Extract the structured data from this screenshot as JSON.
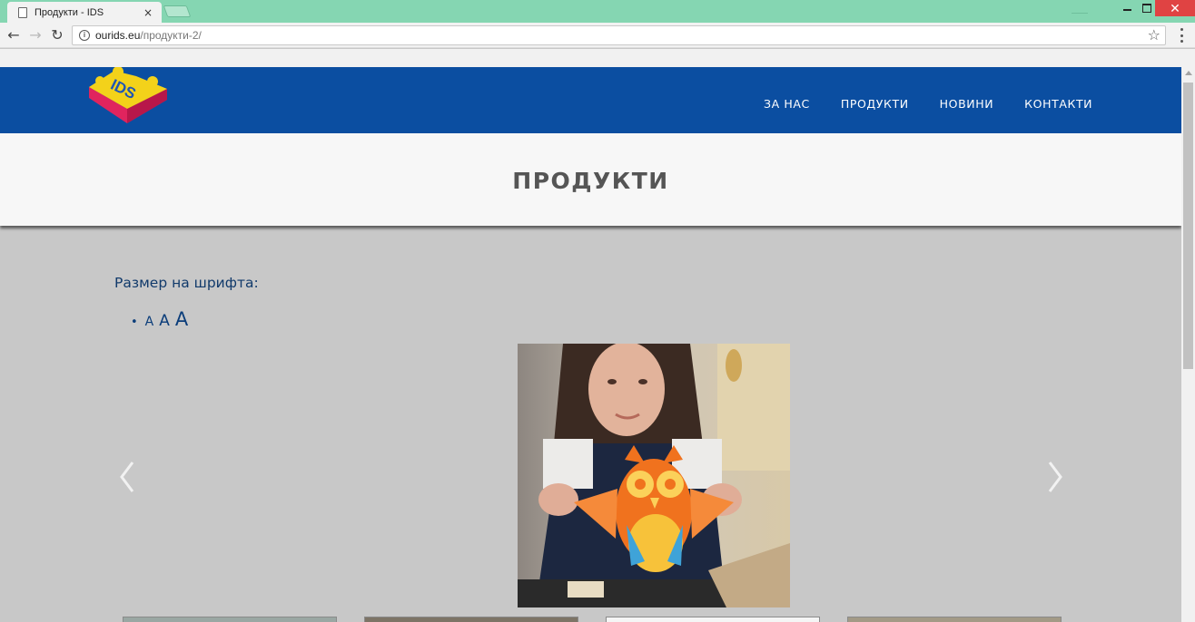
{
  "browser": {
    "tab_title": "Продукти - IDS",
    "tab_close": "×",
    "url_host": "ourids.eu",
    "url_path": "/продукти-2/",
    "close_glyph": "✕"
  },
  "site": {
    "logo_text": "IDS",
    "nav": [
      {
        "label": "ЗА НАС"
      },
      {
        "label": "ПРОДУКТИ"
      },
      {
        "label": "НОВИНИ"
      },
      {
        "label": "КОНТАКТИ"
      }
    ],
    "page_title": "ПРОДУКТИ"
  },
  "font_size": {
    "label": "Размер на шрифта:",
    "options": [
      "A",
      "A",
      "A"
    ]
  },
  "colors": {
    "header_blue": "#0b4ea1",
    "title_band": "#f7f7f7",
    "content_bg": "#c8c8c8",
    "titlebar": "#85d6b2",
    "close_red": "#e04343"
  }
}
